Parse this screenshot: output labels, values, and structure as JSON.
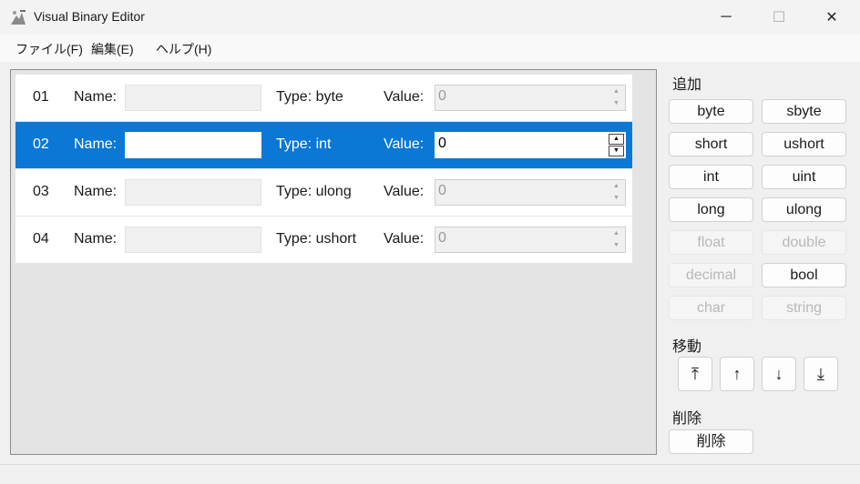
{
  "window": {
    "title": "Visual Binary Editor",
    "icon": "app-icon",
    "controls": {
      "minimize": "─",
      "maximize": "☐",
      "close": "✕"
    }
  },
  "menu": {
    "items": [
      "ファイル(F)",
      "編集(E)",
      "ヘルプ(H)"
    ]
  },
  "labels": {
    "name": "Name:",
    "value": "Value:"
  },
  "rows": [
    {
      "index": "01",
      "type": "Type: byte",
      "name": "",
      "value": "0",
      "selected": false
    },
    {
      "index": "02",
      "type": "Type: int",
      "name": "",
      "value": "0",
      "selected": true
    },
    {
      "index": "03",
      "type": "Type: ulong",
      "name": "",
      "value": "0",
      "selected": false
    },
    {
      "index": "04",
      "type": "Type: ushort",
      "name": "",
      "value": "0",
      "selected": false
    }
  ],
  "add_section": {
    "label": "追加",
    "buttons": [
      {
        "label": "byte",
        "enabled": true
      },
      {
        "label": "sbyte",
        "enabled": true
      },
      {
        "label": "short",
        "enabled": true
      },
      {
        "label": "ushort",
        "enabled": true
      },
      {
        "label": "int",
        "enabled": true
      },
      {
        "label": "uint",
        "enabled": true
      },
      {
        "label": "long",
        "enabled": true
      },
      {
        "label": "ulong",
        "enabled": true
      },
      {
        "label": "float",
        "enabled": false
      },
      {
        "label": "double",
        "enabled": false
      },
      {
        "label": "decimal",
        "enabled": false
      },
      {
        "label": "bool",
        "enabled": true
      },
      {
        "label": "char",
        "enabled": false
      },
      {
        "label": "string",
        "enabled": false
      }
    ]
  },
  "move_section": {
    "label": "移動",
    "buttons": [
      {
        "name": "move-top-button",
        "glyph": "⤒"
      },
      {
        "name": "move-up-button",
        "glyph": "↑"
      },
      {
        "name": "move-down-button",
        "glyph": "↓"
      },
      {
        "name": "move-bottom-button",
        "glyph": "⤓"
      }
    ]
  },
  "delete_section": {
    "label": "削除",
    "button_label": "削除"
  },
  "colors": {
    "selection": "#0a78d4",
    "panel": "#e4e4e4"
  }
}
